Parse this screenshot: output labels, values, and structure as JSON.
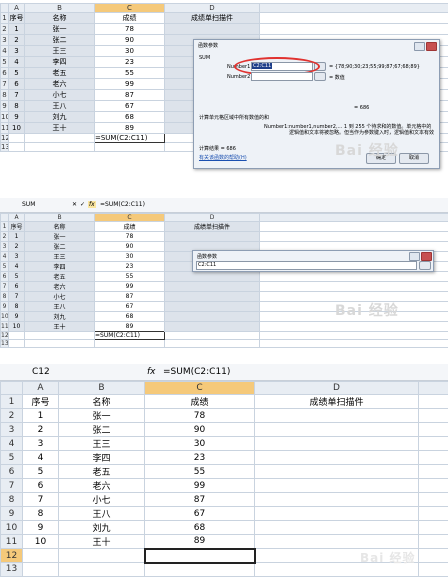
{
  "columns": [
    "A",
    "B",
    "C",
    "D"
  ],
  "headers": [
    "序号",
    "名称",
    "成绩",
    "成绩单扫描件"
  ],
  "rows": [
    [
      "1",
      "张一",
      "78",
      ""
    ],
    [
      "2",
      "张二",
      "90",
      ""
    ],
    [
      "3",
      "王三",
      "30",
      ""
    ],
    [
      "4",
      "李四",
      "23",
      ""
    ],
    [
      "5",
      "老五",
      "55",
      ""
    ],
    [
      "6",
      "老六",
      "99",
      ""
    ],
    [
      "7",
      "小七",
      "87",
      ""
    ],
    [
      "8",
      "王八",
      "67",
      ""
    ],
    [
      "9",
      "刘九",
      "68",
      ""
    ],
    [
      "10",
      "王十",
      "89",
      ""
    ]
  ],
  "row_numbers": [
    "1",
    "2",
    "3",
    "4",
    "5",
    "6",
    "7",
    "8",
    "9",
    "10",
    "11",
    "12",
    "13"
  ],
  "panel1": {
    "formula_cell": "=SUM(C2:C11)",
    "dialog": {
      "title": "函数参数",
      "function_name": "SUM",
      "number1_label": "Number1",
      "number1_value": "C2:C11",
      "number1_result": "= {78;90;30;23;55;99;87;67;68;89}",
      "number2_label": "Number2",
      "number2_result": "= 数值",
      "total": "= 686",
      "description": "计算单元格区域中所有数值的和",
      "param_help_label": "Number1:",
      "param_help": "number1,number2,... 1 到 255 个待求和的数值。单元格中的逻辑值和文本将被忽略。但当作为参数键入时，逻辑值和文本有效",
      "result_label": "计算结果 = 686",
      "help_link": "有关该函数的帮助(H)",
      "ok_label": "确定",
      "cancel_label": "取消"
    }
  },
  "panel2": {
    "name_box": "SUM",
    "fx_symbol": "fx",
    "formula": "=SUM(C2:C11)",
    "cancel_symbol": "✕",
    "enter_symbol": "✓",
    "formula_cell": "=SUM(C2:C11)",
    "dialog": {
      "title": "函数参数",
      "input_value": "C2:C11"
    }
  },
  "panel3": {
    "name_box": "C12",
    "fx_symbol": "fx",
    "formula": "=SUM(C2:C11)"
  },
  "watermark": "Bai 经验",
  "colors": {
    "selected_header": "#f5c97a",
    "annotation_red": "#e0322f",
    "dialog_bg": "#eef2f7"
  }
}
